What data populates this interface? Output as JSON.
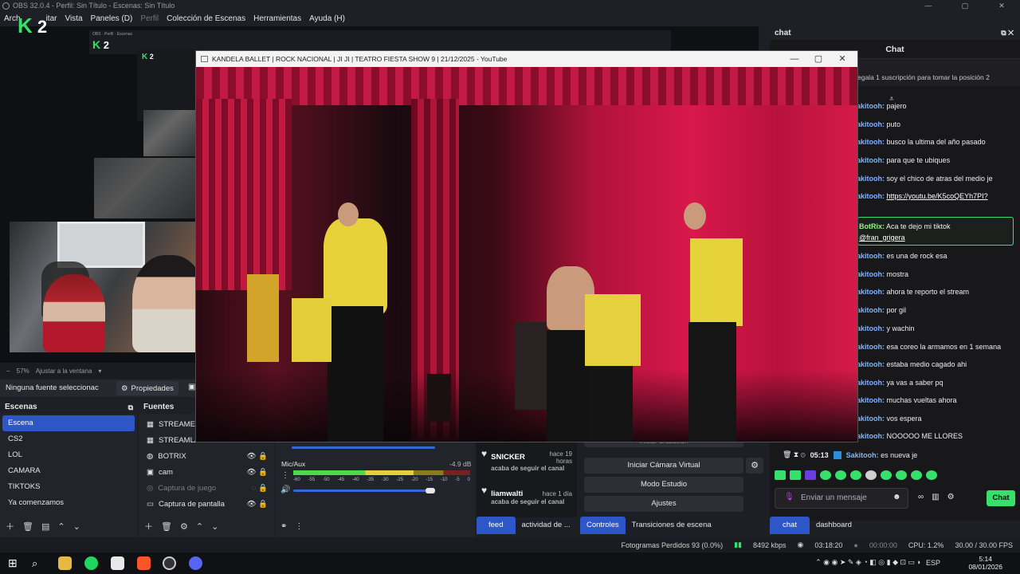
{
  "obs": {
    "title": "OBS 32.0.4 - Perfil: Sin Título - Escenas: Sin Título",
    "menu": [
      "Archivo",
      "Editar",
      "Vista",
      "Paneles (D)",
      "Perfil",
      "Colección de Escenas",
      "Herramientas",
      "Ayuda (H)"
    ],
    "menu_visible": [
      "Arch",
      "itar",
      "Vista",
      "Paneles (D)",
      "Perfil",
      "Colección de Escenas",
      "Herramientas",
      "Ayuda (H)"
    ],
    "win_controls": [
      "—",
      "▢",
      "✕"
    ]
  },
  "overlay_logo": "2",
  "zoom": {
    "percent": "57%",
    "fit_label": "Ajustar a la ventana"
  },
  "source_toolbar": {
    "no_source": "Ninguna fuente seleccionac",
    "properties": "Propiedades"
  },
  "scenes": {
    "title": "Escenas",
    "items": [
      "Escena",
      "CS2",
      "LOL",
      "CAMARA",
      "TIKTOKS",
      "Ya comenzamos"
    ],
    "selected_index": 0
  },
  "sources": {
    "title": "Fuentes",
    "items": [
      {
        "label": "STREAMEL",
        "icon": "scene-icon",
        "dim": false
      },
      {
        "label": "STREAMLA",
        "icon": "scene-icon",
        "dim": false
      },
      {
        "label": "BOTRIX",
        "icon": "globe-icon",
        "dim": false
      },
      {
        "label": "cam",
        "icon": "camera-icon",
        "dim": false
      },
      {
        "label": "Captura de juego",
        "icon": "gamepad-icon",
        "dim": true
      },
      {
        "label": "Captura de pantalla",
        "icon": "monitor-icon",
        "dim": false
      }
    ]
  },
  "mixer": {
    "channel": "Mic/Aux",
    "db": "-4.9 dB",
    "scale": [
      "-60",
      "-55",
      "-50",
      "-45",
      "-40",
      "-35",
      "-30",
      "-25",
      "-20",
      "-15",
      "-10",
      "-5",
      "0"
    ],
    "level": 0.68
  },
  "activity": {
    "items": [
      {
        "name": "SNICKER",
        "time": "hace 19 horas",
        "desc": "acaba de seguir el canal"
      },
      {
        "name": "liamwalti",
        "time": "hace 1 día",
        "desc": "acaba de seguir el canal"
      }
    ],
    "tabs": [
      "feed",
      "actividad de ..."
    ]
  },
  "controls": {
    "partial_top": "Iniciar Grabación",
    "virtual_cam": "Iniciar Cámara Virtual",
    "studio": "Modo Estudio",
    "settings": "Ajustes",
    "tabs": [
      "Controles",
      "Transiciones de escena"
    ]
  },
  "chat": {
    "dock_title": "chat",
    "header": "Chat",
    "promo": "egala 1 suscripción para tomar la posición 2",
    "messages": [
      {
        "user": "akitooh:",
        "text": " pajero"
      },
      {
        "user": "akitooh:",
        "text": " puto"
      },
      {
        "user": "akitooh:",
        "text": " busco la ultima del año pasado"
      },
      {
        "user": "akitooh:",
        "text": " para que te ubiques"
      },
      {
        "user": "akitooh:",
        "text": " soy el chico de atras del medio je"
      },
      {
        "user": "akitooh:",
        "text": " ",
        "link": "https://youtu.be/K5coQEYh7PI?"
      },
      {
        "user": "akitooh:",
        "text": " es una de rock esa"
      },
      {
        "user": "akitooh:",
        "text": " mostra"
      },
      {
        "user": "akitooh:",
        "text": " ahora te reporto el stream"
      },
      {
        "user": "akitooh:",
        "text": " por gil"
      },
      {
        "user": "akitooh:",
        "text": " y wachin"
      },
      {
        "user": "akitooh:",
        "text": " esa coreo la armamos en 1 semana"
      },
      {
        "user": "akitooh:",
        "text": " estaba medio cagado ahi"
      },
      {
        "user": "akitooh:",
        "text": " ya vas a saber pq"
      },
      {
        "user": "akitooh:",
        "text": " muchas vueltas ahora"
      },
      {
        "user": "akitooh:",
        "text": " vos espera"
      },
      {
        "user": "akitooh:",
        "text": " NOOOOO ME LLORES"
      }
    ],
    "bot": {
      "user": "BotRix:",
      "text": " Aca te dejo mi tiktok",
      "handle": "@fran_grigera"
    },
    "last": {
      "time": "05:13",
      "user": "Sakitooh:",
      "text": " es nueva je"
    },
    "input_placeholder": "Enviar un mensaje",
    "send": "Chat",
    "tabs": [
      "chat",
      "dashboard"
    ]
  },
  "status": {
    "dropped": "Fotogramas Perdidos 93 (0.0%)",
    "bitrate": "8492 kbps",
    "live_time": "03:18:20",
    "rec_time": "00:00:00",
    "cpu": "CPU: 1.2%",
    "fps": "30.00 / 30.00 FPS"
  },
  "taskbar": {
    "lang": "ESP",
    "time": "5:14",
    "date": "08/01/2026"
  },
  "youtube": {
    "title": "KANDELA BALLET | ROCK NACIONAL | JI JI | TEATRO FIESTA SHOW 9 | 21/12/2025 - YouTube",
    "controls": [
      "—",
      "▢",
      "✕"
    ]
  },
  "colors": {
    "accent": "#2e56c8",
    "kick_green": "#36e06a",
    "chat_user": "#7fb3ff"
  }
}
